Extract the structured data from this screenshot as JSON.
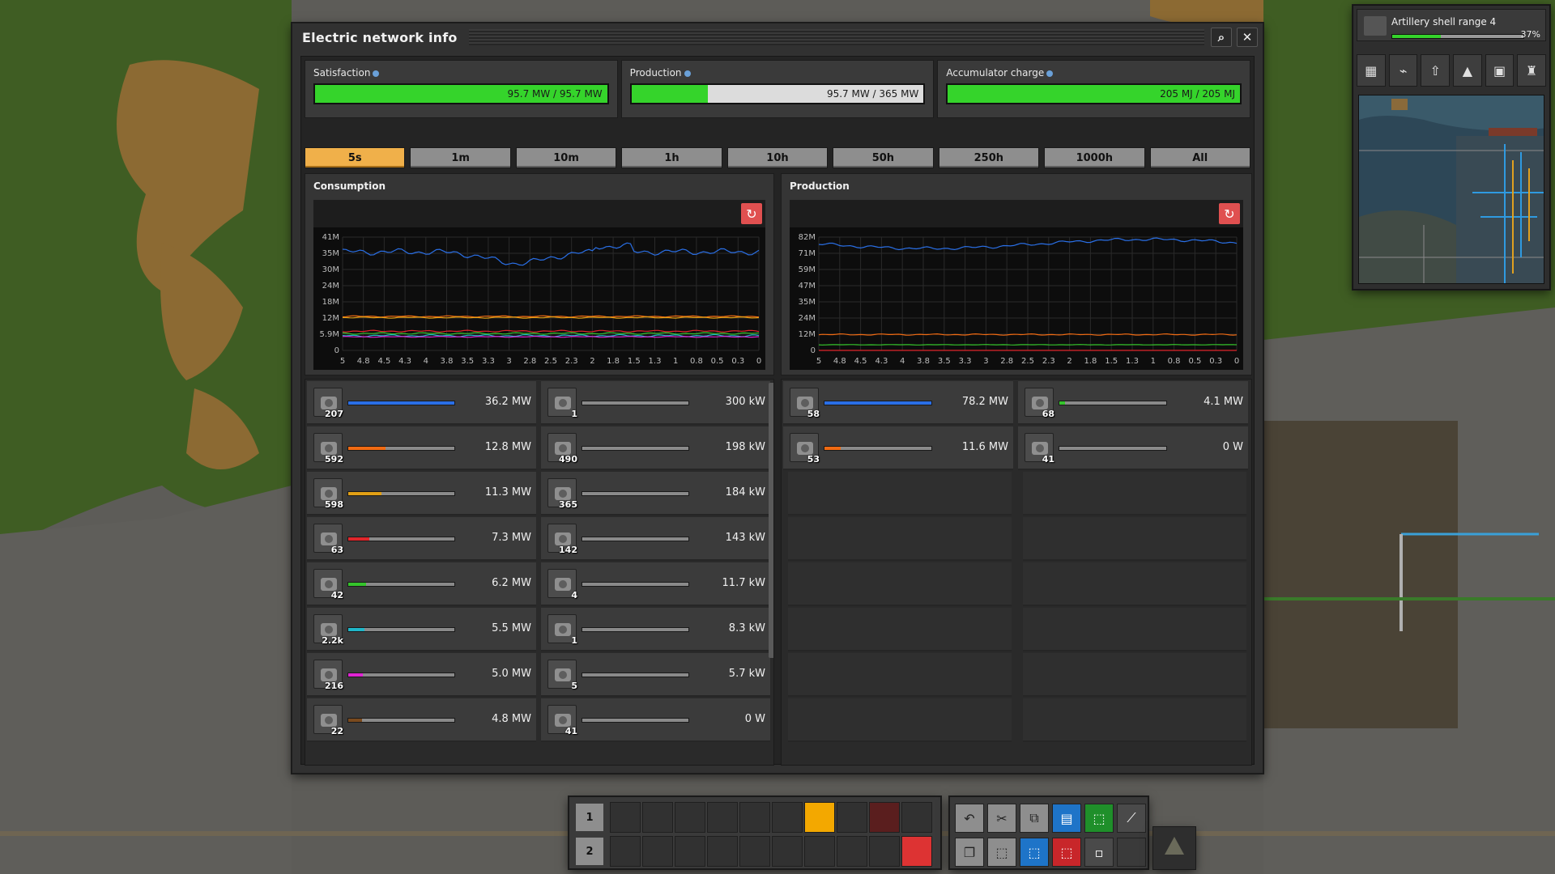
{
  "window": {
    "title": "Electric network info"
  },
  "stats": [
    {
      "label": "Satisfaction",
      "value": "95.7 MW / 95.7 MW",
      "fill": 1.0
    },
    {
      "label": "Production",
      "value": "95.7 MW / 365 MW",
      "fill": 0.262
    },
    {
      "label": "Accumulator charge",
      "value": "205 MJ / 205 MJ",
      "fill": 1.0
    }
  ],
  "tabs": [
    "5s",
    "1m",
    "10m",
    "1h",
    "10h",
    "50h",
    "250h",
    "1000h",
    "All"
  ],
  "active_tab": "5s",
  "consumption": {
    "title": "Consumption",
    "y_ticks": [
      "41M",
      "35M",
      "30M",
      "24M",
      "18M",
      "12M",
      "5.9M",
      "0"
    ],
    "x_ticks": [
      "5",
      "4.8",
      "4.5",
      "4.3",
      "4",
      "3.8",
      "3.5",
      "3.3",
      "3",
      "2.8",
      "2.5",
      "2.3",
      "2",
      "1.8",
      "1.5",
      "1.3",
      "1",
      "0.8",
      "0.5",
      "0.3",
      "0"
    ],
    "items": [
      {
        "icon": "assembling-machine-icon",
        "count": "207",
        "value": "36.2 MW",
        "fill": 1.0,
        "color": "#2a6fe6"
      },
      {
        "icon": "electric-mining-drill-icon",
        "count": "592",
        "value": "12.8 MW",
        "fill": 0.35,
        "color": "#f06a12"
      },
      {
        "icon": "electric-furnace-icon",
        "count": "598",
        "value": "11.3 MW",
        "fill": 0.31,
        "color": "#e2a015"
      },
      {
        "icon": "chemical-plant-icon",
        "count": "63",
        "value": "7.3 MW",
        "fill": 0.2,
        "color": "#e0262b"
      },
      {
        "icon": "lab-icon",
        "count": "42",
        "value": "6.2 MW",
        "fill": 0.17,
        "color": "#35c42b"
      },
      {
        "icon": "fast-inserter-icon",
        "count": "2.2k",
        "value": "5.5 MW",
        "fill": 0.15,
        "color": "#1fb7c9"
      },
      {
        "icon": "beacon-icon",
        "count": "216",
        "value": "5.0 MW",
        "fill": 0.14,
        "color": "#e024d4"
      },
      {
        "icon": "pump-icon",
        "count": "22",
        "value": "4.8 MW",
        "fill": 0.13,
        "color": "#7a4a1e"
      },
      {
        "icon": "radar-icon",
        "count": "1",
        "value": "300 kW",
        "fill": 0.008,
        "color": "#9a9a9a"
      },
      {
        "icon": "long-inserter-icon",
        "count": "490",
        "value": "198 kW",
        "fill": 0.005,
        "color": "#9a9a9a"
      },
      {
        "icon": "inserter-icon",
        "count": "365",
        "value": "184 kW",
        "fill": 0.005,
        "color": "#9a9a9a"
      },
      {
        "icon": "roboport-icon",
        "count": "142",
        "value": "143 kW",
        "fill": 0.004,
        "color": "#9a9a9a"
      },
      {
        "icon": "filter-inserter-icon",
        "count": "4",
        "value": "11.7 kW",
        "fill": 0.0,
        "color": "#9a9a9a"
      },
      {
        "icon": "centrifuge-icon",
        "count": "1",
        "value": "8.3 kW",
        "fill": 0.0,
        "color": "#9a9a9a"
      },
      {
        "icon": "stack-inserter-icon",
        "count": "5",
        "value": "5.7 kW",
        "fill": 0.0,
        "color": "#9a9a9a"
      },
      {
        "icon": "accumulator-icon",
        "count": "41",
        "value": "0 W",
        "fill": 0.0,
        "color": "#9a9a9a"
      }
    ]
  },
  "production": {
    "title": "Production",
    "y_ticks": [
      "82M",
      "71M",
      "59M",
      "47M",
      "35M",
      "24M",
      "12M",
      "0"
    ],
    "x_ticks": [
      "5",
      "4.8",
      "4.5",
      "4.3",
      "4",
      "3.8",
      "3.5",
      "3.3",
      "3",
      "2.8",
      "2.5",
      "2.3",
      "2",
      "1.8",
      "1.5",
      "1.3",
      "1",
      "0.8",
      "0.5",
      "0.3",
      "0"
    ],
    "items": [
      {
        "icon": "steam-engine-icon",
        "count": "58",
        "value": "78.2 MW",
        "fill": 1.0,
        "color": "#2a6fe6"
      },
      {
        "icon": "steam-turbine-icon",
        "count": "53",
        "value": "11.6 MW",
        "fill": 0.15,
        "color": "#f06a12"
      },
      {
        "icon": "solar-panel-icon",
        "count": "68",
        "value": "4.1 MW",
        "fill": 0.05,
        "color": "#35c42b"
      },
      {
        "icon": "accumulator-icon",
        "count": "41",
        "value": "0 W",
        "fill": 0.0,
        "color": "#9a9a9a"
      }
    ]
  },
  "quickbar": {
    "rows": [
      "1",
      "2"
    ]
  },
  "research": {
    "label": "Artillery shell range 4",
    "percent": "37%",
    "progress": 0.37
  }
}
